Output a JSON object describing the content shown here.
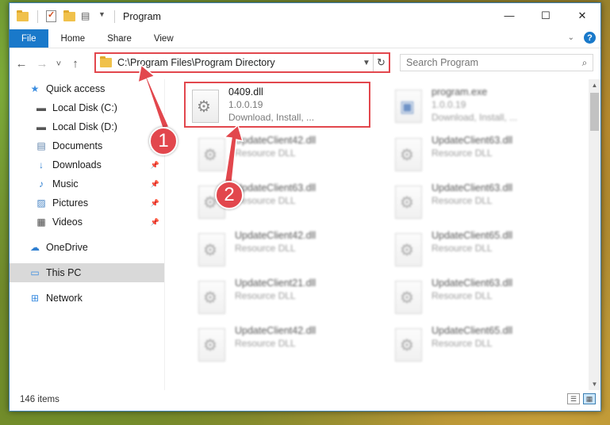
{
  "window": {
    "title": "Program",
    "caption": {
      "minimize": "—",
      "maximize": "☐",
      "close": "✕"
    }
  },
  "ribbon": {
    "tabs": [
      "File",
      "Home",
      "Share",
      "View"
    ],
    "expand_icon": "chevron-down",
    "help": "?"
  },
  "nav": {
    "back": "←",
    "forward": "→",
    "recent": "˅",
    "up": "↑",
    "address": "C:\\Program Files\\Program Directory",
    "search_placeholder": "Search Program"
  },
  "sidebar": {
    "items": [
      {
        "label": "Quick access",
        "icon": "star-icon"
      },
      {
        "label": "Local Disk (C:)",
        "icon": "drive-icon"
      },
      {
        "label": "Local Disk (D:)",
        "icon": "drive-icon"
      },
      {
        "label": "Documents",
        "icon": "documents-icon"
      },
      {
        "label": "Downloads",
        "icon": "download-icon"
      },
      {
        "label": "Music",
        "icon": "music-icon"
      },
      {
        "label": "Pictures",
        "icon": "pictures-icon"
      },
      {
        "label": "Videos",
        "icon": "videos-icon"
      },
      {
        "label": "OneDrive",
        "icon": "cloud-icon"
      },
      {
        "label": "This PC",
        "icon": "computer-icon"
      },
      {
        "label": "Network",
        "icon": "network-icon"
      }
    ]
  },
  "files": [
    {
      "name": "0409.dll",
      "line2": "1.0.0.19",
      "line3": "Download, Install, ..."
    },
    {
      "name": "program.exe",
      "line2": "1.0.0.19",
      "line3": "Download, Install, ..."
    },
    {
      "name": "UpdateClient42.dll",
      "line2": "Resource DLL"
    },
    {
      "name": "UpdateClient63.dll",
      "line2": "Resource DLL"
    },
    {
      "name": "UpdateClient63.dll",
      "line2": "Resource DLL"
    },
    {
      "name": "UpdateClient63.dll",
      "line2": "Resource DLL"
    },
    {
      "name": "UpdateClient42.dll",
      "line2": "Resource DLL"
    },
    {
      "name": "UpdateClient65.dll",
      "line2": "Resource DLL"
    },
    {
      "name": "UpdateClient21.dll",
      "line2": "Resource DLL"
    },
    {
      "name": "UpdateClient63.dll",
      "line2": "Resource DLL"
    },
    {
      "name": "UpdateClient42.dll",
      "line2": "Resource DLL"
    },
    {
      "name": "UpdateClient65.dll",
      "line2": "Resource DLL"
    }
  ],
  "status": {
    "count": "146 items"
  },
  "annotations": [
    "1",
    "2"
  ],
  "colors": {
    "accent": "#1979ca",
    "highlight": "#e2474d",
    "selected": "#d9d9d9"
  }
}
